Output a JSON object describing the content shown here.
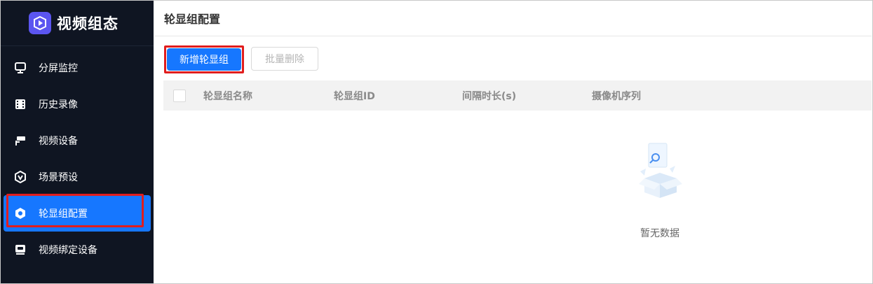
{
  "app": {
    "title": "视频组态"
  },
  "sidebar": {
    "items": [
      {
        "label": "分屏监控",
        "icon": "monitor-icon"
      },
      {
        "label": "历史录像",
        "icon": "film-icon"
      },
      {
        "label": "视频设备",
        "icon": "camera-icon"
      },
      {
        "label": "场景预设",
        "icon": "scene-preset-icon"
      },
      {
        "label": "轮显组配置",
        "icon": "rotation-group-icon",
        "active": true
      },
      {
        "label": "视频绑定设备",
        "icon": "device-bind-icon"
      }
    ]
  },
  "page": {
    "title": "轮显组配置"
  },
  "toolbar": {
    "add_label": "新增轮显组",
    "batch_delete_label": "批量删除"
  },
  "table": {
    "columns": [
      "轮显组名称",
      "轮显组ID",
      "间隔时长(s)",
      "摄像机序列"
    ],
    "rows": []
  },
  "empty": {
    "text": "暂无数据"
  },
  "colors": {
    "sidebar_bg": "#0f1522",
    "accent": "#1677ff",
    "highlight": "#e11d1d"
  }
}
